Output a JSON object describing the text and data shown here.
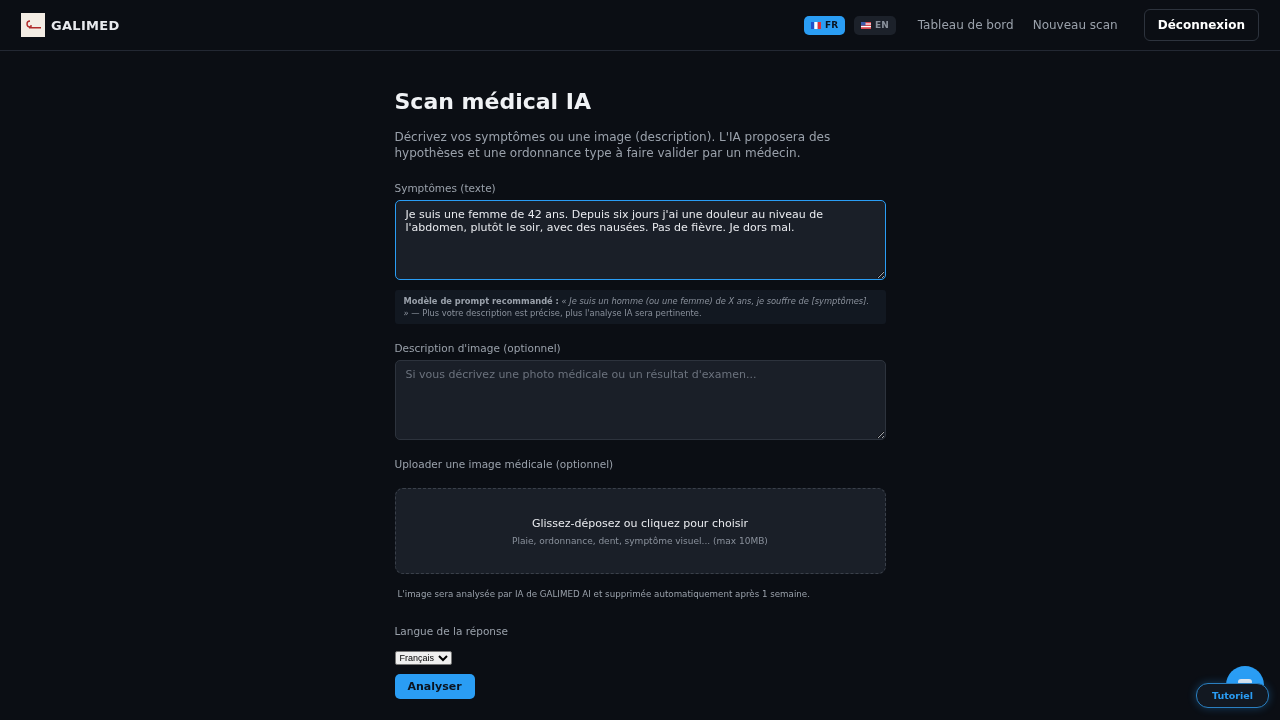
{
  "header": {
    "brand": "GALIMED",
    "languages": [
      {
        "code": "FR",
        "kind": "fr",
        "selected": true
      },
      {
        "code": "EN",
        "kind": "us",
        "selected": false
      }
    ],
    "nav": [
      "Tableau de bord",
      "Nouveau scan"
    ],
    "logout": "Déconnexion"
  },
  "page": {
    "title": "Scan médical IA",
    "intro": "Décrivez vos symptômes ou une image (description). L'IA proposera des hypothèses et une ordonnance type à faire valider par un médecin.",
    "symptoms": {
      "label": "Symptômes (texte)",
      "value": "Je suis une femme de 42 ans. Depuis six jours j'ai une douleur au niveau de l'abdomen, plutôt le soir, avec des nausées. Pas de fièvre. Je dors mal.",
      "focused": true
    },
    "prompt_hint": " **Modèle de prompt recommandé :** *« Je suis un homme (ou une femme) de X ans, je souffre de [symptômes]. »* — Plus votre description est précise, plus l'analyse IA sera pertinente.",
    "image_description": {
      "label": "Description d'image (optionnel)",
      "placeholder": "Si vous décrivez une photo médicale ou un résultat d'examen..."
    },
    "upload": {
      "label": "Uploader une image médicale (optionnel)",
      "title": "Glissez-déposez ou cliquez pour choisir",
      "hint": "Plaie, ordonnance, dent, symptôme visuel... (max 10MB)"
    },
    "upload_note": "L'image sera analysée par IA de GALIMED AI et supprimée automatiquement après 1 semaine.",
    "response_language": {
      "label": "Langue de la réponse",
      "value": "Français"
    },
    "submit": "Analyser"
  },
  "tutorial": "Tutoriel"
}
